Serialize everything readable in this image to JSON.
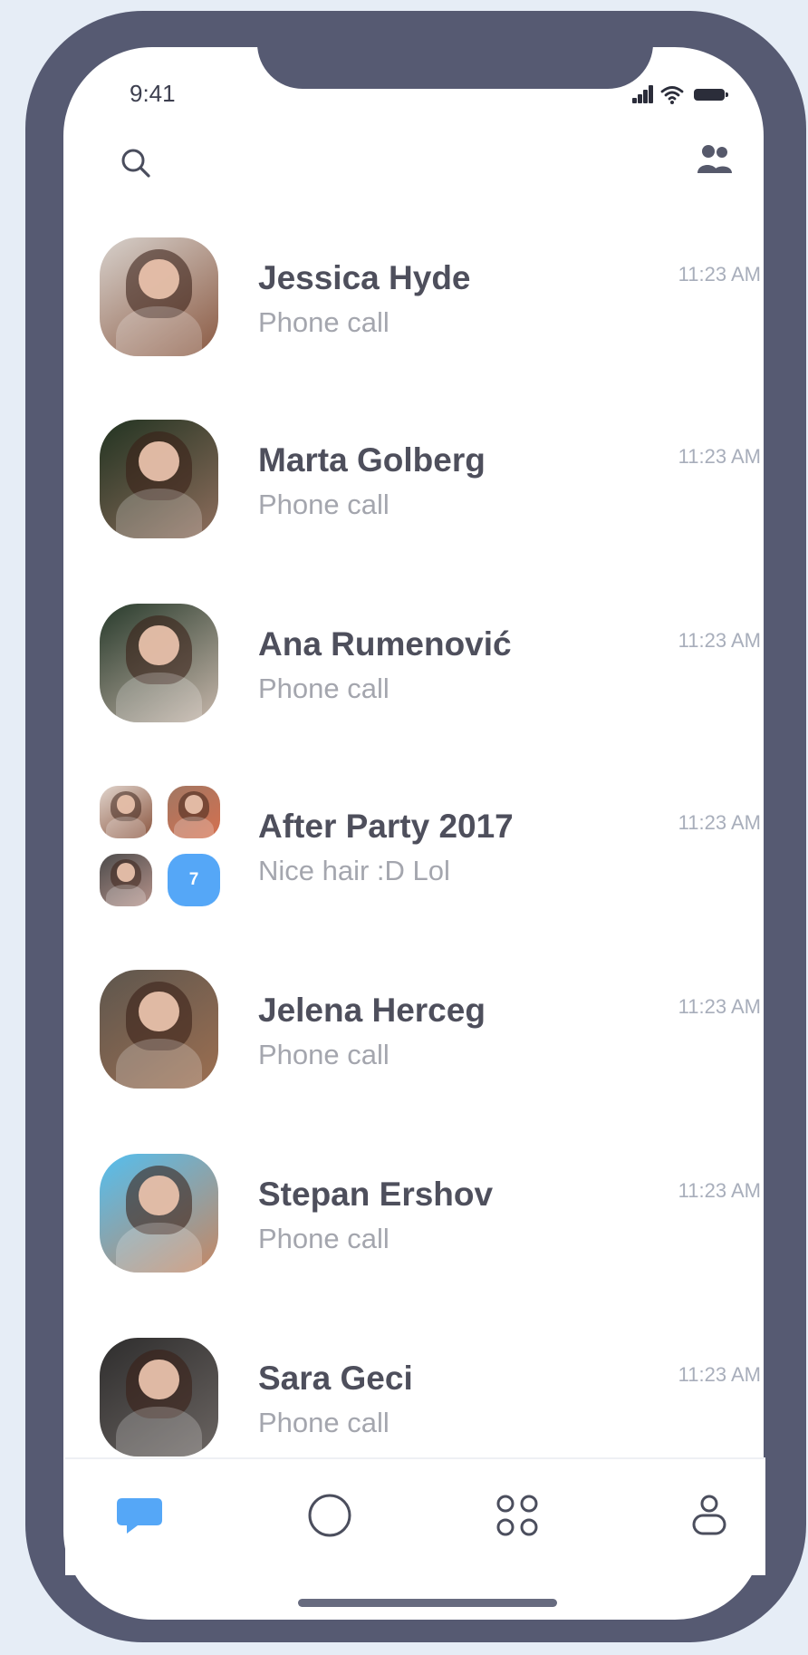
{
  "status_bar": {
    "time": "9:41"
  },
  "chats": [
    {
      "name": "Jessica Hyde",
      "preview": "Phone call",
      "time": "11:23 AM",
      "avatar_type": "person",
      "avatar_colors": [
        "#d7d1cc",
        "#8b5a43"
      ]
    },
    {
      "name": "Marta Golberg",
      "preview": "Phone call",
      "time": "11:23 AM",
      "avatar_type": "person",
      "avatar_colors": [
        "#213321",
        "#8f6e5d"
      ]
    },
    {
      "name": "Ana Rumenović",
      "preview": "Phone call",
      "time": "11:23 AM",
      "avatar_type": "person",
      "avatar_colors": [
        "#273a2b",
        "#c7b7ab"
      ]
    },
    {
      "name": "After Party 2017",
      "preview": "Nice hair :D Lol",
      "time": "11:23 AM",
      "avatar_type": "group",
      "group_count": "7",
      "group_avatars": [
        [
          "#e1d5cd",
          "#8a553f"
        ],
        [
          "#a17763",
          "#d5704f"
        ],
        [
          "#4c4b4b",
          "#b5928a"
        ]
      ]
    },
    {
      "name": "Jelena Herceg",
      "preview": "Phone call",
      "time": "11:23 AM",
      "avatar_type": "person",
      "avatar_colors": [
        "#5d564e",
        "#9d6f51"
      ]
    },
    {
      "name": "Stepan Ershov",
      "preview": "Phone call",
      "time": "11:23 AM",
      "avatar_type": "person",
      "avatar_colors": [
        "#53bff0",
        "#c78661"
      ]
    },
    {
      "name": "Sara Geci",
      "preview": "Phone call",
      "time": "11:23 AM",
      "avatar_type": "person",
      "avatar_colors": [
        "#2e2d2d",
        "#6b6562"
      ]
    }
  ],
  "icons": {
    "search": "search-icon",
    "contacts": "contacts-icon",
    "chat": "chat-icon",
    "circle": "circle-icon",
    "apps": "apps-icon",
    "profile": "profile-icon"
  },
  "colors": {
    "frame": "#565a72",
    "accent": "#55a7f7",
    "text": "#4e4f5c",
    "muted": "#a4a6ae"
  }
}
